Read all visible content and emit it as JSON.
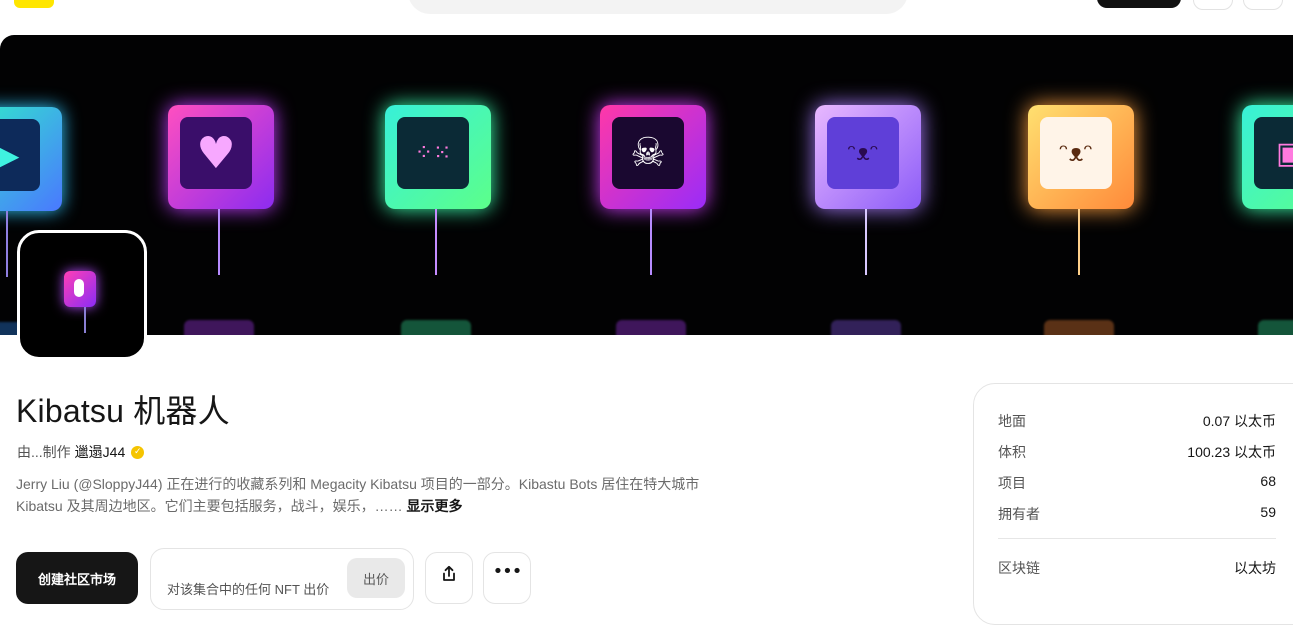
{
  "collection": {
    "title": "Kibatsu 机器人",
    "creator_prefix": "由...制作",
    "creator_name": "邋遢J44",
    "description": "Jerry Liu (@SloppyJ44) 正在进行的收藏系列和 Megacity Kibatsu 项目的一部分。Kibastu Bots 居住在特大城市 Kibatsu 及其周边地区。它们主要包括服务，战斗，娱乐，……",
    "show_more": "显示更多"
  },
  "actions": {
    "create_market": "创建社区市场",
    "offer_prompt": "对该集合中的任何 NFT 出价",
    "offer_button": "出价"
  },
  "stats": {
    "floor": {
      "label": "地面",
      "value": "0.07 以太币"
    },
    "volume": {
      "label": "体积",
      "value": "100.23 以太币"
    },
    "items": {
      "label": "项目",
      "value": "68"
    },
    "owners": {
      "label": "拥有者",
      "value": "59"
    },
    "chain": {
      "label": "区块链",
      "value": "以太坊"
    }
  },
  "icons": {
    "share": "share-icon",
    "more": "more-horizontal-icon",
    "verified": "verified-badge-icon"
  },
  "colors": {
    "accent_yellow": "#ffe600",
    "primary_dark": "#161616",
    "verified": "#f5c400"
  }
}
